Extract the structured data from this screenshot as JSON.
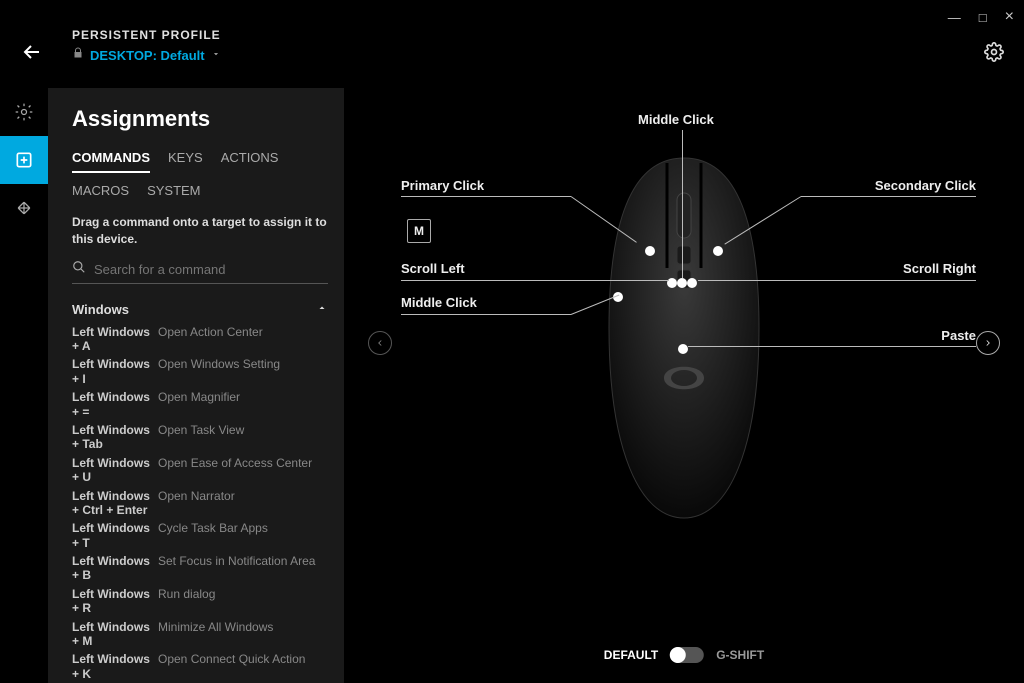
{
  "window": {
    "min": "—",
    "max": "□",
    "close": "×"
  },
  "profile": {
    "title": "PERSISTENT PROFILE",
    "label": "DESKTOP: Default"
  },
  "sidebar": {
    "heading": "Assignments",
    "tabs1": [
      "COMMANDS",
      "KEYS",
      "ACTIONS"
    ],
    "tabs2": [
      "MACROS",
      "SYSTEM"
    ],
    "instruction": "Drag a command onto a target to assign it to this device.",
    "search_placeholder": "Search for a command",
    "category": "Windows",
    "commands": [
      {
        "key": "Left Windows + A",
        "desc": "Open Action Center"
      },
      {
        "key": "Left Windows + I",
        "desc": "Open Windows Setting"
      },
      {
        "key": "Left Windows + =",
        "desc": "Open Magnifier"
      },
      {
        "key": "Left Windows + Tab",
        "desc": "Open Task View"
      },
      {
        "key": "Left Windows + U",
        "desc": "Open Ease of Access Center"
      },
      {
        "key": "Left Windows + Ctrl + Enter",
        "desc": "Open Narrator"
      },
      {
        "key": "Left Windows + T",
        "desc": "Cycle Task Bar Apps"
      },
      {
        "key": "Left Windows + B",
        "desc": "Set Focus in Notification Area"
      },
      {
        "key": "Left Windows + R",
        "desc": "Run dialog"
      },
      {
        "key": "Left Windows + M",
        "desc": "Minimize All Windows"
      },
      {
        "key": "Left Windows + K",
        "desc": "Open Connect Quick Action"
      }
    ]
  },
  "mouse_labels": {
    "middle_click_top": "Middle Click",
    "primary_click": "Primary Click",
    "secondary_click": "Secondary Click",
    "scroll_left": "Scroll Left",
    "scroll_right": "Scroll Right",
    "middle_click_left": "Middle Click",
    "paste": "Paste",
    "m_box": "M"
  },
  "toggle": {
    "default": "DEFAULT",
    "gshift": "G-SHIFT"
  }
}
